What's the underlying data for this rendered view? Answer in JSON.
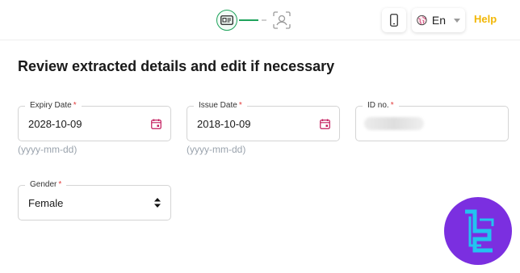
{
  "header": {
    "steps": [
      {
        "name": "id-card-step",
        "state": "active"
      },
      {
        "name": "face-scan-step",
        "state": "pending"
      }
    ],
    "language": {
      "label": "En",
      "icon": "globe-icon"
    },
    "help_label": "Help",
    "colors": {
      "accent": "#1fa35c",
      "help": "#f2b705"
    }
  },
  "main": {
    "title": "Review extracted details and edit if necessary",
    "fields": {
      "expiry_date": {
        "label": "Expiry Date",
        "required": "*",
        "value": "2028-10-09",
        "hint": "(yyyy-mm-dd)"
      },
      "issue_date": {
        "label": "Issue Date",
        "required": "*",
        "value": "2018-10-09",
        "hint": "(yyyy-mm-dd)"
      },
      "id_no": {
        "label": "ID no.",
        "required": "*",
        "value": ""
      },
      "gender": {
        "label": "Gender",
        "required": "*",
        "value": "Female"
      }
    }
  },
  "logo": {
    "icon": "brand-logo-icon",
    "color": "#7b2fe0"
  }
}
